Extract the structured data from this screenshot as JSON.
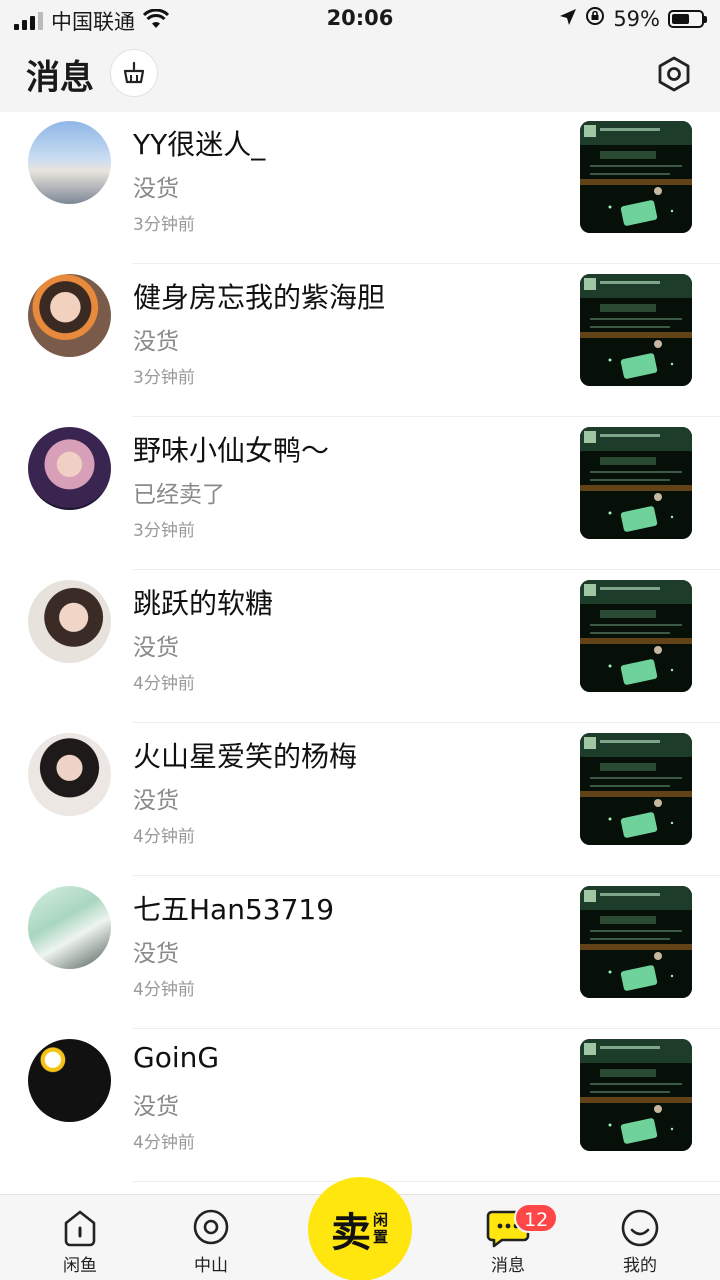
{
  "status_bar": {
    "carrier": "中国联通",
    "time": "20:06",
    "battery": "59%",
    "battery_level": 0.59
  },
  "header": {
    "title": "消息"
  },
  "conversations": [
    {
      "name": "YY很迷人_",
      "message": "没货",
      "time": "3分钟前"
    },
    {
      "name": "健身房忘我的紫海胆",
      "message": "没货",
      "time": "3分钟前"
    },
    {
      "name": "野味小仙女鸭～",
      "message": "已经卖了",
      "time": "3分钟前"
    },
    {
      "name": "跳跃的软糖",
      "message": "没货",
      "time": "4分钟前"
    },
    {
      "name": "火山星爱笑的杨梅",
      "message": "没货",
      "time": "4分钟前"
    },
    {
      "name": "七五Han53719",
      "message": "没货",
      "time": "4分钟前"
    },
    {
      "name": "GoinG",
      "message": "没货",
      "time": "4分钟前"
    }
  ],
  "tabbar": {
    "home": "闲鱼",
    "location": "中山",
    "sell_main": "卖",
    "sell_sub": "闲置",
    "messages": "消息",
    "messages_badge": "12",
    "me": "我的"
  },
  "colors": {
    "accent": "#ffe60f",
    "badge": "#ff4747"
  }
}
